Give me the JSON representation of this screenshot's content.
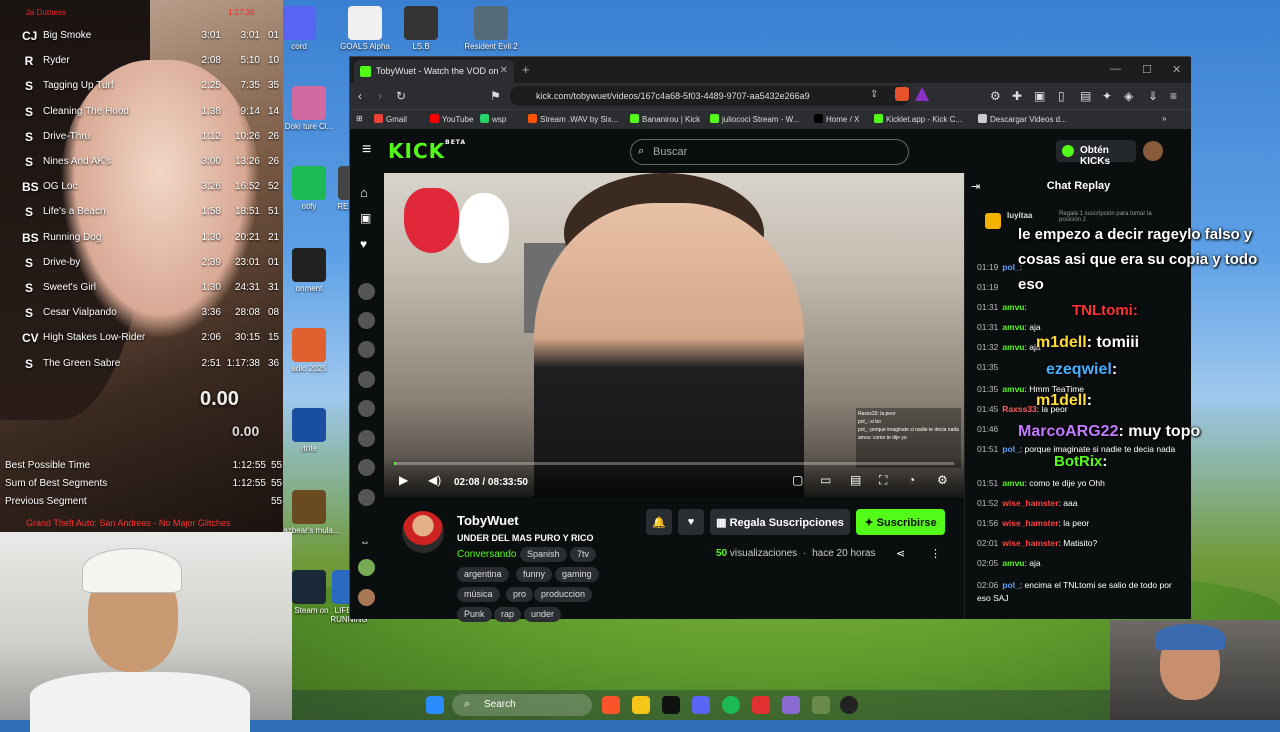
{
  "splits": {
    "title": "Ja Dutness",
    "top_time": "1:17:36",
    "rows": [
      {
        "icon": "CJ",
        "name": "Big Smoke",
        "delta": "3:01",
        "time": "3:01",
        "seg": "01"
      },
      {
        "icon": "R",
        "name": "Ryder",
        "delta": "2:08",
        "time": "5:10",
        "seg": "10"
      },
      {
        "icon": "S",
        "name": "Tagging Up Turf",
        "delta": "2:25",
        "time": "7:35",
        "seg": "35"
      },
      {
        "icon": "S",
        "name": "Cleaning The Hood",
        "delta": "1:38",
        "time": "9:14",
        "seg": "14"
      },
      {
        "icon": "S",
        "name": "Drive-Thru",
        "delta": "1:12",
        "time": "10:26",
        "seg": "26"
      },
      {
        "icon": "S",
        "name": "Nines And AK's",
        "delta": "3:00",
        "time": "13:26",
        "seg": "26"
      },
      {
        "icon": "BS",
        "name": "OG Loc",
        "delta": "3:26",
        "time": "16:52",
        "seg": "52"
      },
      {
        "icon": "S",
        "name": "Life's a Beach",
        "delta": "1:58",
        "time": "18:51",
        "seg": "51"
      },
      {
        "icon": "BS",
        "name": "Running Dog",
        "delta": "1:30",
        "time": "20:21",
        "seg": "21"
      },
      {
        "icon": "S",
        "name": "Drive-by",
        "delta": "2:39",
        "time": "23:01",
        "seg": "01"
      },
      {
        "icon": "S",
        "name": "Sweet's Girl",
        "delta": "1:30",
        "time": "24:31",
        "seg": "31"
      },
      {
        "icon": "S",
        "name": "Cesar Vialpando",
        "delta": "3:36",
        "time": "28:08",
        "seg": "08"
      },
      {
        "icon": "CV",
        "name": "High Stakes Low-Rider",
        "delta": "2:06",
        "time": "30:15",
        "seg": "15"
      },
      {
        "icon": "S",
        "name": "The Green Sabre",
        "delta": "2:51",
        "time": "1:17:38",
        "seg": "36"
      }
    ],
    "big_time": "0.00",
    "small_time": "0.00",
    "stats": [
      {
        "label": "Best Possible Time",
        "value": "1:12:55",
        "extra": "55"
      },
      {
        "label": "Sum of Best Segments",
        "value": "1:12:55",
        "extra": "55"
      },
      {
        "label": "Previous Segment",
        "value": "",
        "extra": "55"
      }
    ],
    "footer": "Grand Theft Auto: San Andreas - No Major Glitches"
  },
  "desktop_icons": [
    {
      "label": "cord",
      "color": "#5865f2"
    },
    {
      "label": "GOALS Alpha",
      "color": "#f0f0f0"
    },
    {
      "label": "LS.B",
      "color": "#333333"
    },
    {
      "label": "Resident Evil 2",
      "color": "#556b7a"
    },
    {
      "label": "Doki ture Cl...",
      "color": "#d06aa0"
    },
    {
      "label": "otify",
      "color": "#1db954"
    },
    {
      "label": "RE2k Ven",
      "color": "#444444"
    },
    {
      "label": "onment",
      "color": "#222222"
    },
    {
      "label": "adio 2025",
      "color": "#e06030"
    },
    {
      "label": "rtrite",
      "color": "#1a4ea0"
    },
    {
      "label": "Fazbear's mula...",
      "color": "#6a4a20"
    },
    {
      "label": "r Steam on",
      "color": "#1b2838"
    },
    {
      "label": "LIFE'S - RUNNING",
      "color": "#2a6ac0"
    },
    {
      "label": "Launcher",
      "color": "#333333"
    }
  ],
  "browser": {
    "tab_title": "TobyWuet - Watch the VOD on",
    "url": "kick.com/tobywuet/videos/167c4a68-5f03-4489-9707-aa5432e266a9",
    "bookmarks": [
      {
        "label": "Gmail",
        "color": "#ea4335"
      },
      {
        "label": "YouTube",
        "color": "#ff0000"
      },
      {
        "label": "wsp",
        "color": "#25d366"
      },
      {
        "label": "Stream .WAV by Six...",
        "color": "#ff5500"
      },
      {
        "label": "Bananirou | Kick",
        "color": "#53fc18"
      },
      {
        "label": "juliococi Stream - W...",
        "color": "#53fc18"
      },
      {
        "label": "Home / X",
        "color": "#000000"
      },
      {
        "label": "Kicklet.app - Kick C...",
        "color": "#53fc18"
      },
      {
        "label": "Descargar Videos d...",
        "color": "#cccccc"
      }
    ]
  },
  "kick": {
    "logo": "KICK",
    "logo_badge": "BETA",
    "search_placeholder": "Buscar",
    "get_kicks": "Obtén KICKs",
    "channel_name": "TobyWuet",
    "stream_title": "UNDER DEL MAS PURO Y RICO",
    "category": "Conversando",
    "tags_row1": [
      "Spanish",
      "7tv"
    ],
    "tags_row2": [
      "argentina",
      "funny",
      "gaming"
    ],
    "tags_row3": [
      "música",
      "pro",
      "produccion"
    ],
    "tags_row4": [
      "Punk",
      "rap",
      "under"
    ],
    "gift_label": "Regala Suscripciones",
    "subscribe_label": "Suscribirse",
    "views_count": "50",
    "views_label": "visualizaciones",
    "time_ago": "hace 20 horas",
    "current_time": "02:08 / 08:33:50",
    "progress": 0.004,
    "accent": "#53fc18"
  },
  "chat": {
    "title": "Chat Replay",
    "pinned_user": "luyitaa",
    "pinned_text": "Regala 1 suscripción para tomar la posición 2",
    "messages": [
      {
        "time": "01:19",
        "user": "pol_",
        "ucolor": "#5aa0ff",
        "text": ""
      },
      {
        "time": "01:19",
        "user": "",
        "ucolor": "#ffffff",
        "text": ""
      },
      {
        "time": "01:31",
        "user": "amvu",
        "ucolor": "#53fc18",
        "text": ""
      },
      {
        "time": "01:31",
        "user": "amvu",
        "ucolor": "#53fc18",
        "text": "aja"
      },
      {
        "time": "01:32",
        "user": "amvu",
        "ucolor": "#53fc18",
        "text": "aja"
      },
      {
        "time": "01:35",
        "user": "",
        "ucolor": "#ffffff",
        "text": ""
      },
      {
        "time": "01:35",
        "user": "amvu",
        "ucolor": "#53fc18",
        "text": "Hmm TeaTime"
      },
      {
        "time": "01:45",
        "user": "Raxss33",
        "ucolor": "#ff6060",
        "text": "la peor"
      },
      {
        "time": "01:46",
        "user": "",
        "ucolor": "#ffffff",
        "text": ""
      },
      {
        "time": "01:51",
        "user": "pol_",
        "ucolor": "#5aa0ff",
        "text": "porque imaginate si nadie te decia nada"
      },
      {
        "time": "01:51",
        "user": "amvu",
        "ucolor": "#53fc18",
        "text": "como te dije yo Ohh"
      },
      {
        "time": "01:52",
        "user": "wise_hamster",
        "ucolor": "#ff4040",
        "text": "aaa"
      },
      {
        "time": "01:56",
        "user": "wise_hamster",
        "ucolor": "#ff4040",
        "text": "la peor"
      },
      {
        "time": "02:01",
        "user": "wise_hamster",
        "ucolor": "#ff4040",
        "text": "Matisito?"
      },
      {
        "time": "02:05",
        "user": "amvu",
        "ucolor": "#53fc18",
        "text": "aja"
      },
      {
        "time": "02:06",
        "user": "pol_",
        "ucolor": "#5aa0ff",
        "text": "encima el TNLtomi se salio de todo por eso SAJ"
      }
    ]
  },
  "overlay_chat": {
    "line1": "le empezo a decir rageylo falso y",
    "line2": "cosas asi que era su copia y todo",
    "line3": "eso",
    "tnl": "TNLtomi:",
    "m1_user": "m1dell",
    "m1_text": ": tomiii",
    "eze_user": "ezeqwiel",
    "eze_text": ":",
    "m1b_user": "m1dell",
    "m1b_text": ":",
    "marco_user": "MarcoARG22",
    "marco_text": ": muy topo",
    "bot_user": "BotRix",
    "bot_text": ":"
  },
  "video_chat": [
    "Raxss33: la peor",
    "pol_: si bo",
    "pol_: porque imaginate si nadie te decia nada",
    "amvu: como te dije yo"
  ],
  "taskbar": {
    "search_label": "Search"
  }
}
